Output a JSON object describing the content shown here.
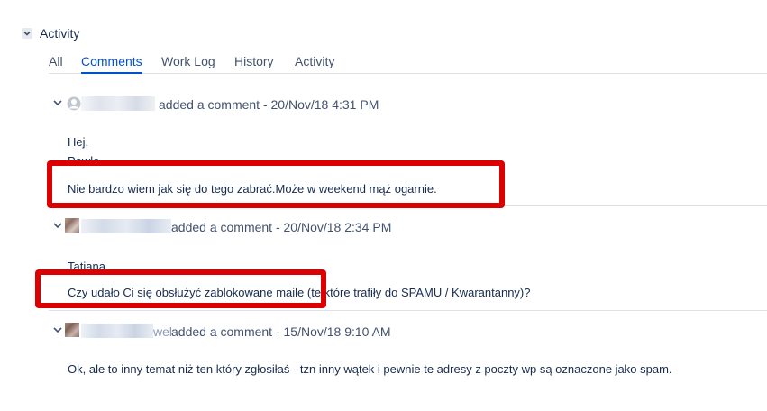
{
  "section": {
    "title": "Activity",
    "toggle_icon": "chevron-down-icon"
  },
  "tabs": [
    {
      "label": "All",
      "active": false
    },
    {
      "label": "Comments",
      "active": true
    },
    {
      "label": "Work Log",
      "active": false
    },
    {
      "label": "History",
      "active": false
    },
    {
      "label": "Activity",
      "active": false
    }
  ],
  "comments": [
    {
      "meta": "added a comment - 20/Nov/18 4:31 PM",
      "avatar": "default-user-icon",
      "lines": [
        "Hej,",
        "Pawle",
        "Nie bardzo wiem jak się do tego zabrać.Może w weekend mąż ogarnie."
      ]
    },
    {
      "meta": "added a comment - 20/Nov/18 2:34 PM",
      "avatar": "user-photo",
      "lines": [
        "Tatiana,",
        "Czy udało Ci się obsłużyć zablokowane maile (te które trafiły do SPAMU / Kwarantanny)?"
      ]
    },
    {
      "name_suffix": "wel",
      "meta": "added a comment - 15/Nov/18 9:10 AM",
      "avatar": "user-photo",
      "lines": [
        "Ok, ale to inny temat niż ten który zgłosiłaś - tzn inny wątek i pewnie te adresy z poczty wp są oznaczone jako spam."
      ]
    }
  ],
  "colors": {
    "accent": "#0052cc",
    "highlight": "#dd0000",
    "text": "#172b4d",
    "muted": "#42526e"
  }
}
